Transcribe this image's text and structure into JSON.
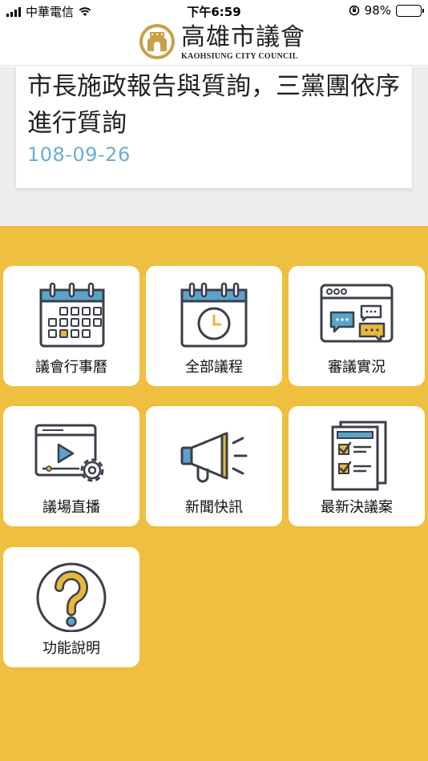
{
  "statusbar": {
    "carrier": "中華電信",
    "time": "下午6:59",
    "battery": "98%"
  },
  "header": {
    "logo_cn": "高雄市議會",
    "logo_en": "KAOHSIUNG CITY COUNCIL"
  },
  "news": {
    "title": "市長施政報告與質詢，三黨團依序進行質詢",
    "date": "108-09-26"
  },
  "menu": [
    {
      "label": "議會行事曆",
      "icon": "calendar-icon"
    },
    {
      "label": "全部議程",
      "icon": "calendar-clock-icon"
    },
    {
      "label": "審議實況",
      "icon": "chat-browser-icon"
    },
    {
      "label": "議場直播",
      "icon": "video-gear-icon"
    },
    {
      "label": "新聞快訊",
      "icon": "megaphone-icon"
    },
    {
      "label": "最新決議案",
      "icon": "checklist-icon"
    },
    {
      "label": "功能說明",
      "icon": "help-icon"
    }
  ],
  "colors": {
    "panel": "#efbf3f",
    "accent_blue": "#5ba3c9",
    "date": "#6aaed0",
    "icon_gold": "#e8b83a",
    "icon_dark": "#3a3f4a"
  }
}
